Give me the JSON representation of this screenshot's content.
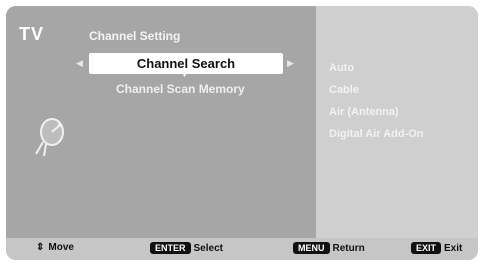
{
  "header": {
    "tv_label": "TV",
    "title": "Channel Setting"
  },
  "menu": {
    "selected_label": "Channel Search",
    "item_2": "Channel Scan Memory"
  },
  "options": [
    "Auto",
    "Cable",
    "Air (Antenna)",
    "Digital Air Add-On"
  ],
  "footer": {
    "move_label": "Move",
    "enter_key": "ENTER",
    "select_label": "Select",
    "menu_key": "MENU",
    "return_label": "Return",
    "exit_key": "EXIT",
    "exit_label": "Exit"
  },
  "icons": {
    "side": "satellite-dish-icon",
    "move": "up-down-arrow-icon"
  },
  "colors": {
    "left_panel": "#a6a6a6",
    "right_panel": "#cfcfcf",
    "highlight": "#ffffff",
    "footer": "#c6c6c6"
  }
}
